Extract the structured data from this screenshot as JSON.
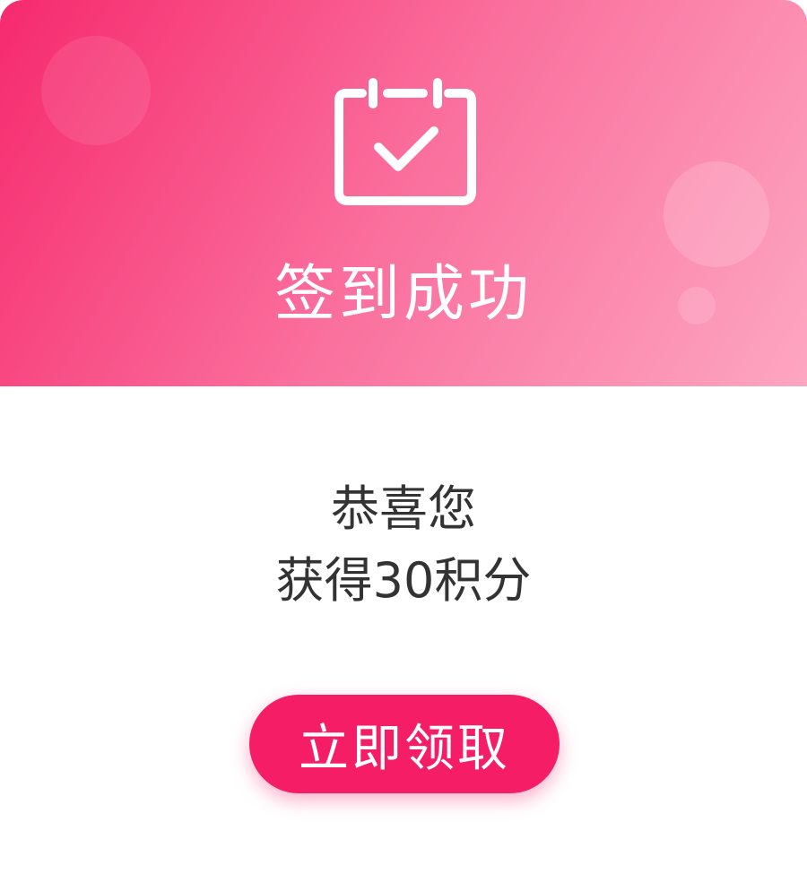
{
  "header": {
    "title": "签到成功",
    "icon": "calendar-check-icon",
    "gradient_start": "#f62a6e",
    "gradient_end": "#fda6c2"
  },
  "message": {
    "line1": "恭喜您",
    "line2": "获得30积分"
  },
  "claim_button": {
    "label": "立即领取",
    "color": "#f51e66"
  }
}
